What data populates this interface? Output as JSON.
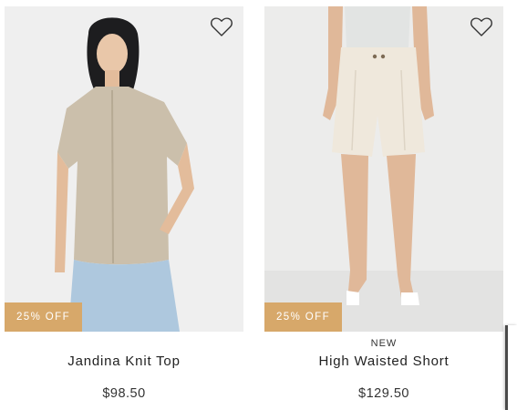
{
  "products": [
    {
      "name": "Jandina Knit Top",
      "price": "$98.50",
      "badge": "25% OFF",
      "tag": "",
      "wishlist_icon": "heart-outline-icon"
    },
    {
      "name": "High Waisted Short",
      "price": "$129.50",
      "badge": "25% OFF",
      "tag": "NEW",
      "wishlist_icon": "heart-outline-icon"
    }
  ],
  "colors": {
    "badge_bg": "#d7a86a",
    "badge_text": "#ffffff",
    "photo_bg": "#efefef"
  }
}
